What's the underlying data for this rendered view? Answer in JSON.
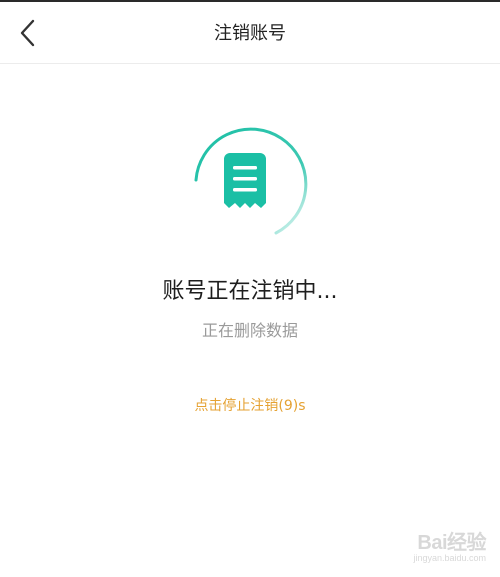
{
  "header": {
    "title": "注销账号",
    "back_icon": "chevron-left-icon"
  },
  "status": {
    "icon": "receipt-document-icon",
    "title": "账号正在注销中...",
    "subtitle": "正在删除数据",
    "stop_label": "点击停止注销(9)s"
  },
  "watermark": {
    "name": "Bai经验",
    "url": "jingyan.baidu.com"
  },
  "colors": {
    "accent_teal": "#1bbfa5",
    "link_orange": "#e5a233",
    "title_text": "#1e1e1e",
    "sub_text": "#9a9a9a"
  }
}
